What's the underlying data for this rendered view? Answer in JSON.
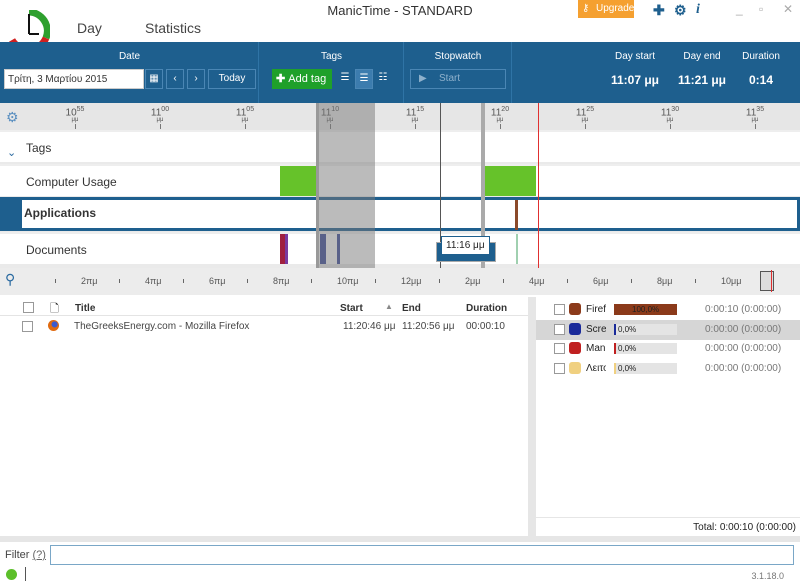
{
  "window": {
    "title": "ManicTime - STANDARD",
    "upgrade": "Upgrade",
    "icons": [
      "puzzle-icon",
      "gear-icon",
      "info-icon"
    ]
  },
  "tabs": [
    {
      "label": "Day",
      "active": true
    },
    {
      "label": "Statistics",
      "active": false
    }
  ],
  "toolbar": {
    "date_header": "Date",
    "date_value": "Τρίτη, 3 Μαρτίου 2015",
    "today": "Today",
    "tags_header": "Tags",
    "add_tag": "Add tag",
    "stopwatch_header": "Stopwatch",
    "start": "Start",
    "day_start_label": "Day start",
    "day_start": "11:07 μμ",
    "day_end_label": "Day end",
    "day_end": "11:21 μμ",
    "duration_label": "Duration",
    "duration": "0:14"
  },
  "timeline": {
    "ticks": [
      {
        "h": "10",
        "m": "55"
      },
      {
        "h": "11",
        "m": "00"
      },
      {
        "h": "11",
        "m": "05"
      },
      {
        "h": "11",
        "m": "10"
      },
      {
        "h": "11",
        "m": "15"
      },
      {
        "h": "11",
        "m": "20"
      },
      {
        "h": "11",
        "m": "25"
      },
      {
        "h": "11",
        "m": "30"
      },
      {
        "h": "11",
        "m": "35"
      }
    ],
    "suffix": "μμ",
    "rows": [
      "Tags",
      "Computer Usage",
      "Applications",
      "Documents"
    ],
    "tooltip": "11:16 μμ",
    "colors": {
      "active": "#66c22a",
      "selected": "#5f8a3a",
      "now": "#e03030"
    }
  },
  "overview": {
    "labels": [
      "2πμ",
      "4πμ",
      "6πμ",
      "8πμ",
      "10πμ",
      "12μμ",
      "2μμ",
      "4μμ",
      "6μμ",
      "8μμ",
      "10μμ"
    ]
  },
  "list": {
    "columns": [
      "Title",
      "Start",
      "End",
      "Duration"
    ],
    "rows": [
      {
        "title": "TheGreeksEnergy.com - Mozilla Firefox",
        "start": "11:20:46 μμ",
        "end": "11:20:56 μμ",
        "duration": "00:00:10"
      }
    ]
  },
  "apps": {
    "items": [
      {
        "name": "Firefox",
        "percent": 100.0,
        "label": "100,0%",
        "time": "0:00:10 (0:00:00)",
        "color": "#8b3a1a"
      },
      {
        "name": "Screenpresso",
        "percent": 0,
        "label": "0,0%",
        "time": "0:00:00 (0:00:00)",
        "color": "#1a2a9a"
      },
      {
        "name": "ManicTime",
        "percent": 0,
        "label": "0,0%",
        "time": "0:00:00 (0:00:00)",
        "color": "#c02020"
      },
      {
        "name": "Λειτουργίες",
        "percent": 0,
        "label": "0,0%",
        "time": "0:00:00 (0:00:00)",
        "color": "#f0d080"
      }
    ],
    "total": "Total: 0:00:10 (0:00:00)"
  },
  "filter": {
    "label": "Filter",
    "help": "(?)",
    "value": ""
  },
  "status": {
    "version": "3.1.18.0"
  }
}
